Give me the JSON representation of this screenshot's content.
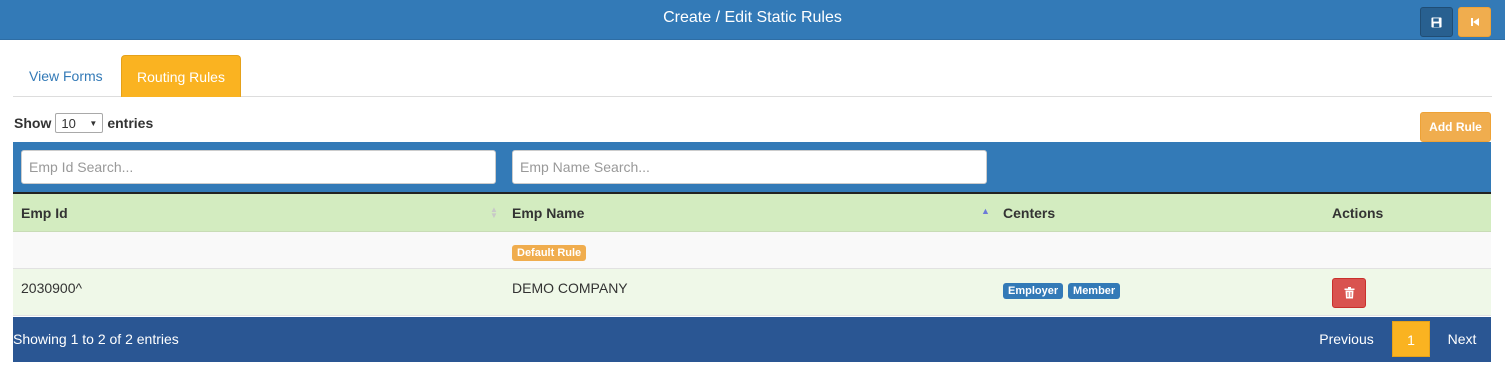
{
  "header": {
    "title": "Create / Edit Static Rules",
    "save_icon": "floppy-disk-icon",
    "back_icon": "step-backward-icon"
  },
  "tabs": [
    {
      "label": "View Forms",
      "active": false
    },
    {
      "label": "Routing Rules",
      "active": true
    }
  ],
  "length_menu": {
    "prefix": "Show",
    "value": "10",
    "suffix": "entries"
  },
  "add_rule_label": "Add Rule",
  "search": {
    "emp_id_placeholder": "Emp Id Search...",
    "emp_name_placeholder": "Emp Name Search..."
  },
  "table": {
    "columns": [
      "Emp Id",
      "Emp Name",
      "Centers",
      "Actions"
    ],
    "rows": [
      {
        "emp_id": "",
        "emp_name_badge": "Default Rule",
        "centers": [],
        "has_delete": false
      },
      {
        "emp_id": "2030900^",
        "emp_name": "DEMO COMPANY",
        "centers": [
          "Employer",
          "Member"
        ],
        "has_delete": true
      }
    ]
  },
  "footer": {
    "info": "Showing 1 to 2 of 2 entries",
    "previous": "Previous",
    "current_page": "1",
    "next": "Next"
  },
  "colors": {
    "header_blue": "#337ab7",
    "accent_orange": "#fab321",
    "table_header_green": "#d3ecc0",
    "footer_blue": "#2a5693",
    "danger_red": "#d9534f"
  }
}
